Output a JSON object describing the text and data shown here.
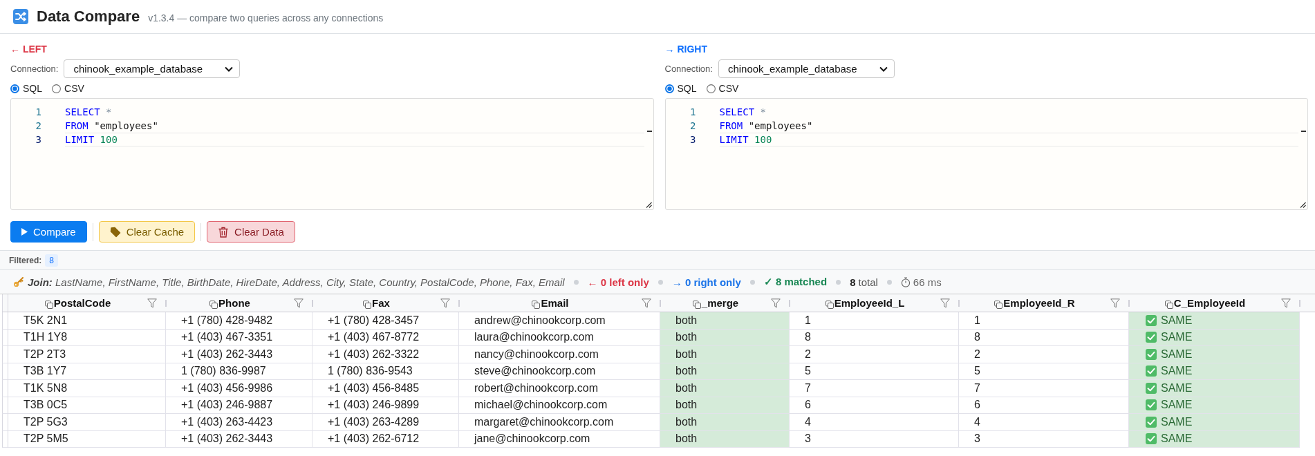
{
  "app_header": {
    "title": "Data Compare",
    "subtitle": "v1.3.4 — compare two queries across any connections"
  },
  "panels": [
    {
      "heading": "← LEFT",
      "color": "#dc3545",
      "connection_label": "Connection:",
      "connection": "chinook_example_database",
      "source_options": [
        {
          "label": "SQL",
          "selected": true
        },
        {
          "label": "CSV",
          "selected": false
        }
      ],
      "editor_lines": [
        {
          "number": "1",
          "active": false,
          "tokens": [
            {
              "kind": "keyword",
              "text": "SELECT"
            },
            {
              "kind": "operator",
              "text": "*"
            }
          ]
        },
        {
          "number": "2",
          "active": false,
          "tokens": [
            {
              "kind": "keyword",
              "text": "FROM"
            },
            {
              "kind": "string",
              "text": "\"employees\""
            }
          ]
        },
        {
          "number": "3",
          "active": true,
          "tokens": [
            {
              "kind": "keyword",
              "text": "LIMIT"
            },
            {
              "kind": "number",
              "text": "100"
            }
          ]
        }
      ]
    },
    {
      "heading": "→ RIGHT",
      "color": "#0d6efd",
      "connection_label": "Connection:",
      "connection": "chinook_example_database",
      "source_options": [
        {
          "label": "SQL",
          "selected": true
        },
        {
          "label": "CSV",
          "selected": false
        }
      ],
      "editor_lines": [
        {
          "number": "1",
          "active": false,
          "tokens": [
            {
              "kind": "keyword",
              "text": "SELECT"
            },
            {
              "kind": "operator",
              "text": "*"
            }
          ]
        },
        {
          "number": "2",
          "active": false,
          "tokens": [
            {
              "kind": "keyword",
              "text": "FROM"
            },
            {
              "kind": "string",
              "text": "\"employees\""
            }
          ]
        },
        {
          "number": "3",
          "active": true,
          "tokens": [
            {
              "kind": "keyword",
              "text": "LIMIT"
            },
            {
              "kind": "number",
              "text": "100"
            }
          ]
        }
      ]
    }
  ],
  "actions": [
    {
      "kind": "primary",
      "label": "Compare"
    },
    {
      "kind": "warning",
      "label": "Clear Cache"
    },
    {
      "kind": "danger",
      "label": "Clear Data"
    }
  ],
  "filter_bar": {
    "label": "Filtered:",
    "count": "8"
  },
  "join_summary": {
    "text": "**Join:** LastName, FirstName, Title, BirthDate, HireDate, Address, City, State, Country, PostalCode, Phone, Fax, Email",
    "stats": [
      {
        "kind": "left_only",
        "text": "← 0 left only"
      },
      {
        "kind": "right_only",
        "text": "→ 0 right only"
      },
      {
        "kind": "matched",
        "text": "✓ 8 matched"
      },
      {
        "kind": "total",
        "text": "**8** total"
      },
      {
        "kind": "timing",
        "text": "66 ms"
      }
    ]
  },
  "table": {
    "columns": [
      {
        "name": "PostalCode",
        "kind": "data"
      },
      {
        "name": "Phone",
        "kind": "data"
      },
      {
        "name": "Fax",
        "kind": "data"
      },
      {
        "name": "Email",
        "kind": "data"
      },
      {
        "name": "_merge",
        "kind": "merge"
      },
      {
        "name": "EmployeeId_L",
        "kind": "data"
      },
      {
        "name": "EmployeeId_R",
        "kind": "data"
      },
      {
        "name": "C_EmployeeId",
        "kind": "compare"
      }
    ],
    "rows": [
      [
        "T5K 2N1",
        "+1 (780) 428-9482",
        "+1 (780) 428-3457",
        "andrew@chinookcorp.com",
        "both",
        "1",
        "1",
        "SAME"
      ],
      [
        "T1H 1Y8",
        "+1 (403) 467-3351",
        "+1 (403) 467-8772",
        "laura@chinookcorp.com",
        "both",
        "8",
        "8",
        "SAME"
      ],
      [
        "T2P 2T3",
        "+1 (403) 262-3443",
        "+1 (403) 262-3322",
        "nancy@chinookcorp.com",
        "both",
        "2",
        "2",
        "SAME"
      ],
      [
        "T3B 1Y7",
        "1 (780) 836-9987",
        "1 (780) 836-9543",
        "steve@chinookcorp.com",
        "both",
        "5",
        "5",
        "SAME"
      ],
      [
        "T1K 5N8",
        "+1 (403) 456-9986",
        "+1 (403) 456-8485",
        "robert@chinookcorp.com",
        "both",
        "7",
        "7",
        "SAME"
      ],
      [
        "T3B 0C5",
        "+1 (403) 246-9887",
        "+1 (403) 246-9899",
        "michael@chinookcorp.com",
        "both",
        "6",
        "6",
        "SAME"
      ],
      [
        "T2P 5G3",
        "+1 (403) 263-4423",
        "+1 (403) 263-4289",
        "margaret@chinookcorp.com",
        "both",
        "4",
        "4",
        "SAME"
      ],
      [
        "T2P 5M5",
        "+1 (403) 262-3443",
        "+1 (403) 262-6712",
        "jane@chinookcorp.com",
        "both",
        "3",
        "3",
        "SAME"
      ]
    ]
  }
}
